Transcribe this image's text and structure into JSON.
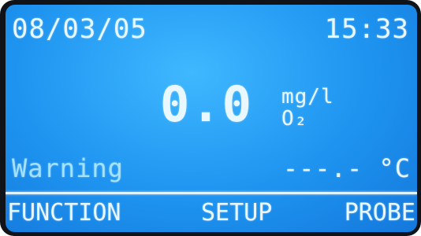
{
  "header": {
    "date": "08/03/05",
    "time": "15:33"
  },
  "reading": {
    "value": "0.0",
    "unit": "mg/l",
    "parameter": "O₂"
  },
  "status": {
    "warning_label": "Warning",
    "temperature": "---.- °C"
  },
  "softkeys": {
    "function_label": "FUNCTION",
    "setup_label": "SETUP",
    "probe_label": "PROBE"
  },
  "colors": {
    "screen_background": "#1e94f0",
    "text": "#e9f7ff",
    "bezel": "#101418"
  }
}
